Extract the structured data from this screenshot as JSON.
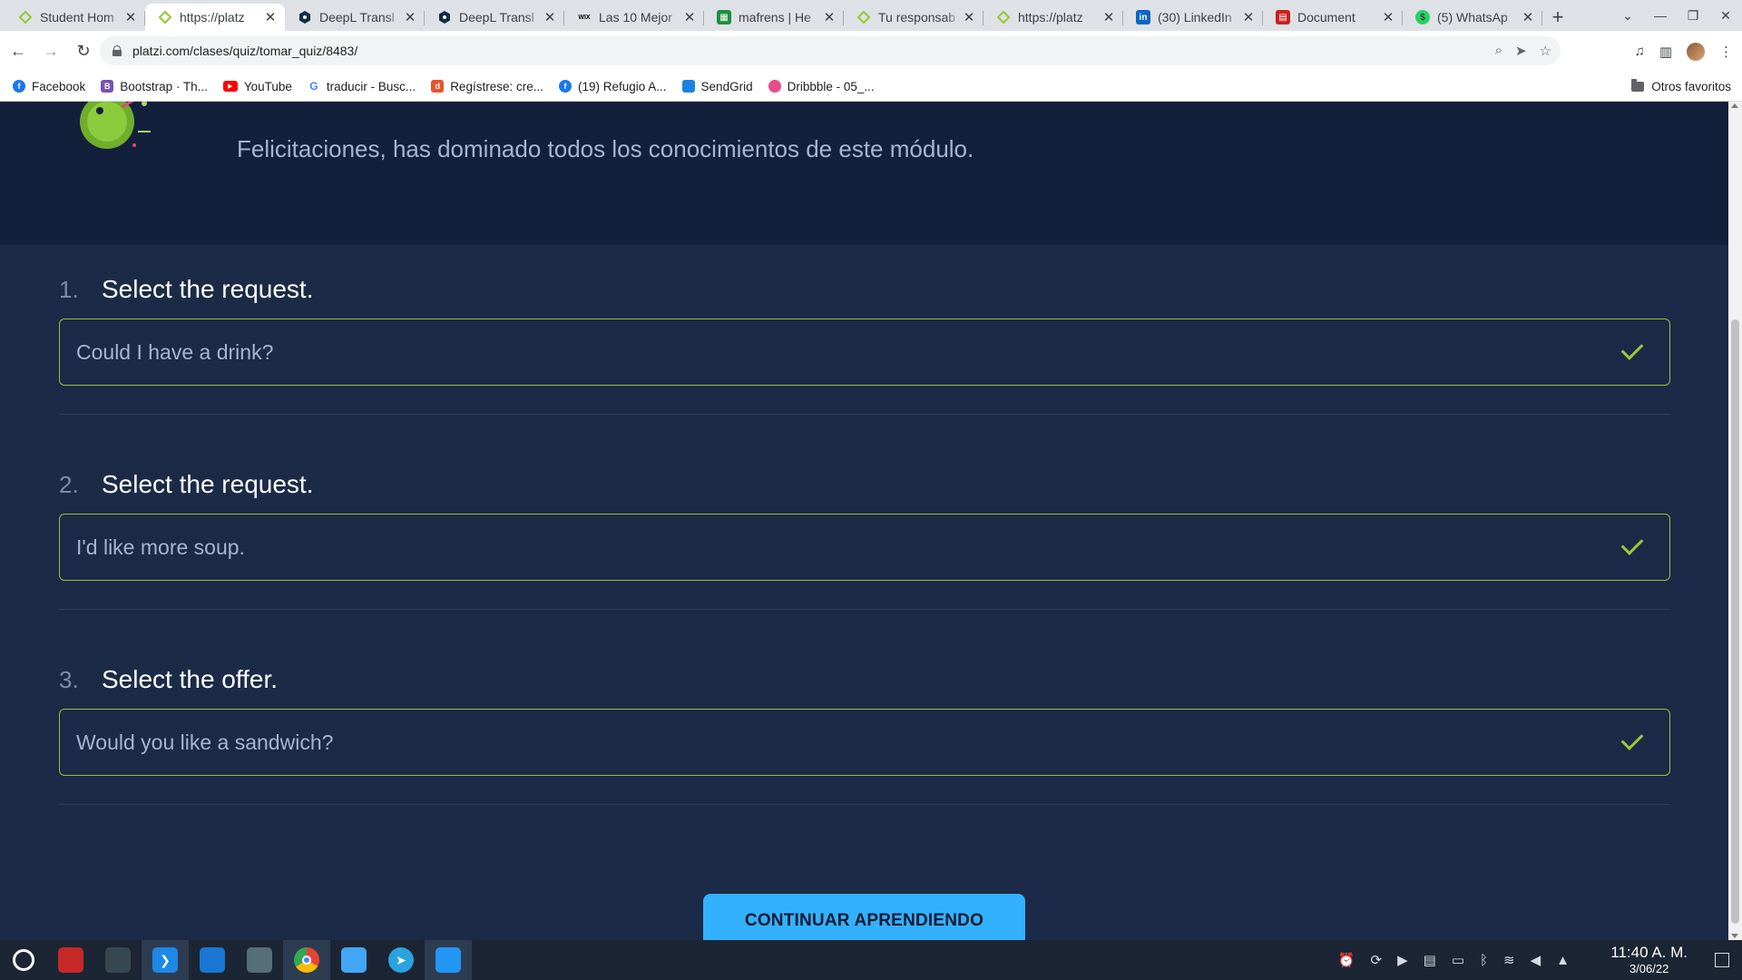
{
  "browser": {
    "tabs": [
      {
        "title": "Student Hom",
        "icon": "platzi-icon",
        "color": "#98ca3f",
        "active": false
      },
      {
        "title": "https://platz",
        "icon": "platzi-icon",
        "color": "#98ca3f",
        "active": true
      },
      {
        "title": "DeepL Transl",
        "icon": "deepl-icon",
        "color": "#0f2b46",
        "active": false
      },
      {
        "title": "DeepL Transl",
        "icon": "deepl-icon",
        "color": "#0f2b46",
        "active": false
      },
      {
        "title": "Las 10 Mejor",
        "icon": "wix-icon",
        "glyph": "WIX",
        "color": "#000000",
        "active": false
      },
      {
        "title": "mafrens | He",
        "icon": "sheet-icon",
        "color": "#1e8e3e",
        "active": false
      },
      {
        "title": "Tu responsab",
        "icon": "platzi-icon",
        "color": "#98ca3f",
        "active": false
      },
      {
        "title": "https://platz",
        "icon": "platzi-icon",
        "color": "#98ca3f",
        "active": false
      },
      {
        "title": "(30) LinkedIn",
        "icon": "linkedin-icon",
        "glyph": "in",
        "color": "#0a66c2",
        "active": false
      },
      {
        "title": "Document",
        "icon": "document-icon",
        "color": "#c5221f",
        "active": false
      },
      {
        "title": "(5) WhatsAp",
        "icon": "whatsapp-icon",
        "color": "#25d366",
        "active": false
      }
    ],
    "new_tab": "+",
    "url": "platzi.com/clases/quiz/tomar_quiz/8483/",
    "bookmarks": [
      {
        "label": "Facebook",
        "icon": "facebook-icon",
        "glyph": "f",
        "color": "#1877f2"
      },
      {
        "label": "Bootstrap · Th...",
        "icon": "bootstrap-icon",
        "glyph": "B",
        "color": "#7952b3"
      },
      {
        "label": "YouTube",
        "icon": "youtube-icon",
        "glyph": "▶",
        "color": "#ff0000"
      },
      {
        "label": "traducir - Busc...",
        "icon": "google-icon",
        "glyph": "G",
        "color": "#4285f4"
      },
      {
        "label": "Regístrese: cre...",
        "icon": "register-icon",
        "glyph": "d",
        "color": "#e8532c"
      },
      {
        "label": "(19) Refugio A...",
        "icon": "facebook-icon",
        "glyph": "f",
        "color": "#1877f2"
      },
      {
        "label": "SendGrid",
        "icon": "sendgrid-icon",
        "glyph": "",
        "color": "#1a82e2"
      },
      {
        "label": "Dribbble - 05_...",
        "icon": "dribbble-icon",
        "glyph": "",
        "color": "#ea4c89"
      }
    ],
    "other_bookmarks": "Otros favoritos"
  },
  "page": {
    "hero_message": "Felicitaciones, has dominado todos los conocimientos de este módulo.",
    "questions": [
      {
        "number": "1.",
        "prompt": "Select the request.",
        "answer": "Could I have a drink?",
        "status": "correct"
      },
      {
        "number": "2.",
        "prompt": "Select the request.",
        "answer": "I'd like more soup.",
        "status": "correct"
      },
      {
        "number": "3.",
        "prompt": "Select the offer.",
        "answer": "Would you like a sandwich?",
        "status": "correct"
      }
    ],
    "continue_button": "CONTINUAR APRENDIENDO",
    "colors": {
      "accent": "#33b1ff",
      "correct": "#9cbf3b",
      "background": "#1b2a46",
      "hero": "#13203b"
    }
  },
  "taskbar": {
    "apps": [
      {
        "icon": "system-menu-icon",
        "color": "#1b2533"
      },
      {
        "icon": "terminal-icon",
        "color": "#c62828"
      },
      {
        "icon": "control-panel-icon",
        "color": "#37474f"
      },
      {
        "icon": "vscode-icon",
        "color": "#1e88e5",
        "active": true
      },
      {
        "icon": "store-icon",
        "color": "#1976d2"
      },
      {
        "icon": "remote-desktop-icon",
        "color": "#546e7a"
      },
      {
        "icon": "chrome-icon",
        "color": "#fbbc04",
        "active": true
      },
      {
        "icon": "file-manager-icon",
        "color": "#42a5f5"
      },
      {
        "icon": "telegram-icon",
        "color": "#2aa3df"
      },
      {
        "icon": "notes-icon",
        "color": "#2196f3",
        "active": true
      }
    ],
    "time": "11:40 A. M.",
    "date": "3/06/22"
  }
}
